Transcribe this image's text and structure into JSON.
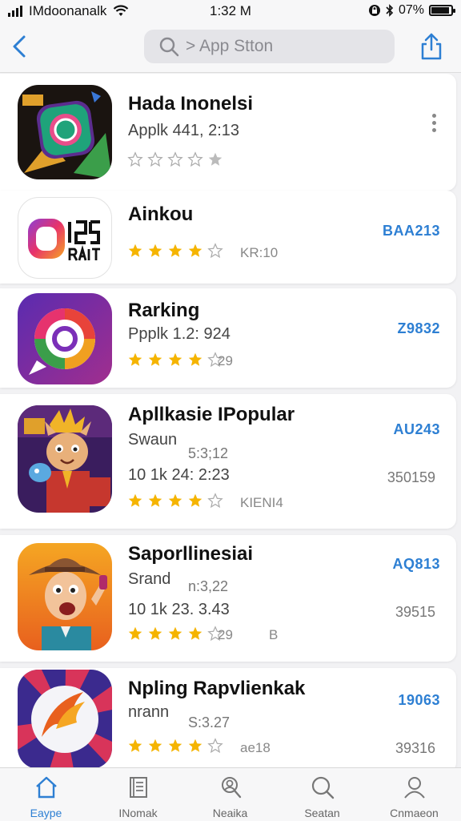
{
  "status_bar": {
    "carrier": "IMdoonanalk",
    "time": "1:32 M",
    "battery": "07%"
  },
  "nav": {
    "search_placeholder": "> App Stton"
  },
  "apps": [
    {
      "name": "Hada Inonelsi",
      "line2": "Applk 441, 2:13",
      "rating": 1,
      "menu": true
    },
    {
      "name": "Ainkou",
      "rating": 4,
      "rating_text": "KR:10",
      "price": "BAA213"
    },
    {
      "name": "Rarking",
      "line2": "Ppplk 1.2: 924",
      "rating": 4,
      "rating_text": "29",
      "price": "Z9832"
    },
    {
      "name": "Apllkasie IPopular",
      "sub": "Swaun",
      "mid": "5:3;12",
      "meta": "10 1k 24: 2:23",
      "rating": 4,
      "rating_text": "KIENI4",
      "price": "AU243",
      "right_num": "350159"
    },
    {
      "name": "Saporllinesiai",
      "sub": "Srand",
      "mid": "n:3,22",
      "meta": "10 1k 23. 3.43",
      "rating": 4,
      "rating_text": "29",
      "rating_extra": "B",
      "price": "AQ813",
      "right_num": "39515"
    },
    {
      "name": "Npling Rapvlienkak",
      "sub": "nrann",
      "mid": "S:3.27",
      "rating": 4,
      "rating_text": "ae18",
      "price": "19063",
      "right_num": "39316"
    }
  ],
  "tabs": [
    {
      "label": "Eaype",
      "icon": "home-icon",
      "active": true
    },
    {
      "label": "INomak",
      "icon": "book-icon",
      "active": false
    },
    {
      "label": "Neaika",
      "icon": "profile-search-icon",
      "active": false
    },
    {
      "label": "Seatan",
      "icon": "search-icon",
      "active": false
    },
    {
      "label": "Cnmaeon",
      "icon": "person-icon",
      "active": false
    }
  ],
  "colors": {
    "accent": "#2d7fd3",
    "star": "#f5b400"
  }
}
